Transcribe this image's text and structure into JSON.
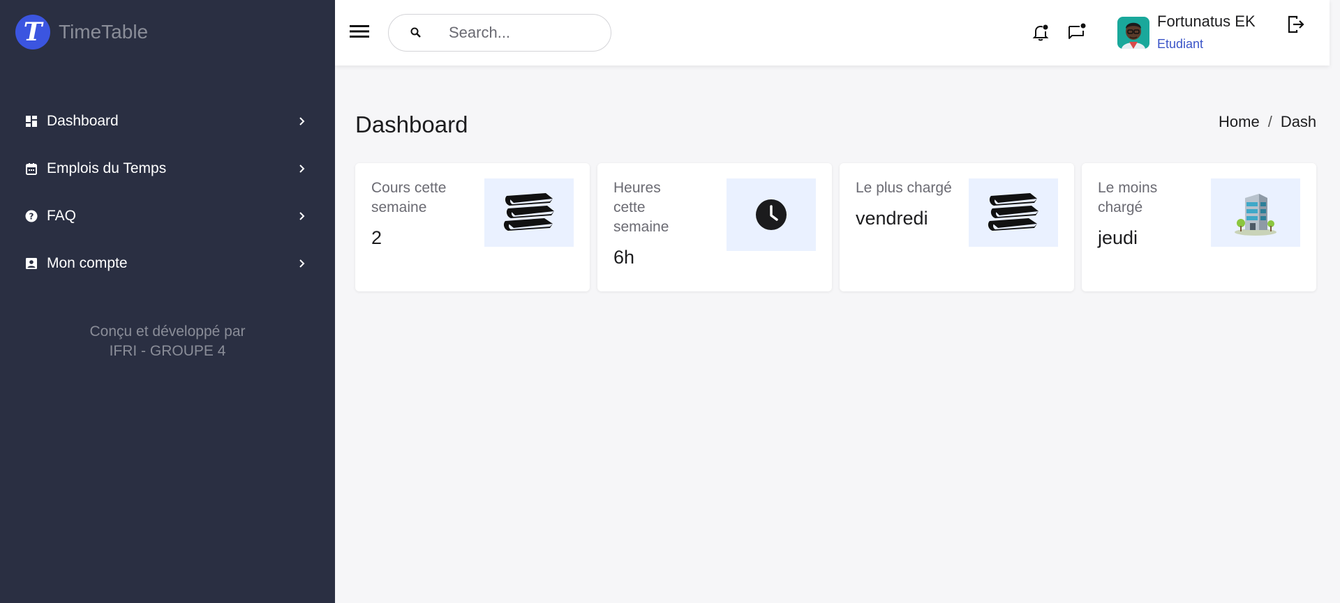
{
  "brand": {
    "logo_letter": "T",
    "name": "TimeTable"
  },
  "sidebar": {
    "items": [
      {
        "label": "Dashboard",
        "icon": "dashboard-icon"
      },
      {
        "label": "Emplois du Temps",
        "icon": "calendar-icon"
      },
      {
        "label": "FAQ",
        "icon": "help-icon"
      },
      {
        "label": "Mon compte",
        "icon": "account-box-icon"
      }
    ],
    "credits_line1": "Conçu et développé par",
    "credits_line2": "IFRI - GROUPE 4"
  },
  "header": {
    "search_placeholder": "Search...",
    "user_name": "Fortunatus EK",
    "user_role": "Etudiant"
  },
  "main": {
    "title": "Dashboard",
    "breadcrumb": [
      "Home",
      "/",
      "Dash"
    ],
    "cards": [
      {
        "label": "Cours cette semaine",
        "value": "2",
        "icon": "books-icon"
      },
      {
        "label": "Heures cette semaine",
        "value": "6h",
        "icon": "clock-icon"
      },
      {
        "label": "Le plus chargé",
        "value": "vendredi",
        "icon": "books-icon"
      },
      {
        "label": "Le moins chargé",
        "value": "jeudi",
        "icon": "office-building-icon"
      }
    ]
  },
  "colors": {
    "sidebar_bg": "#2a2f42",
    "brand_blue": "#3b55e0",
    "role_blue": "#3b55c8",
    "icon_box_bg": "#eaf1ff",
    "page_bg": "#f6f6f8"
  }
}
